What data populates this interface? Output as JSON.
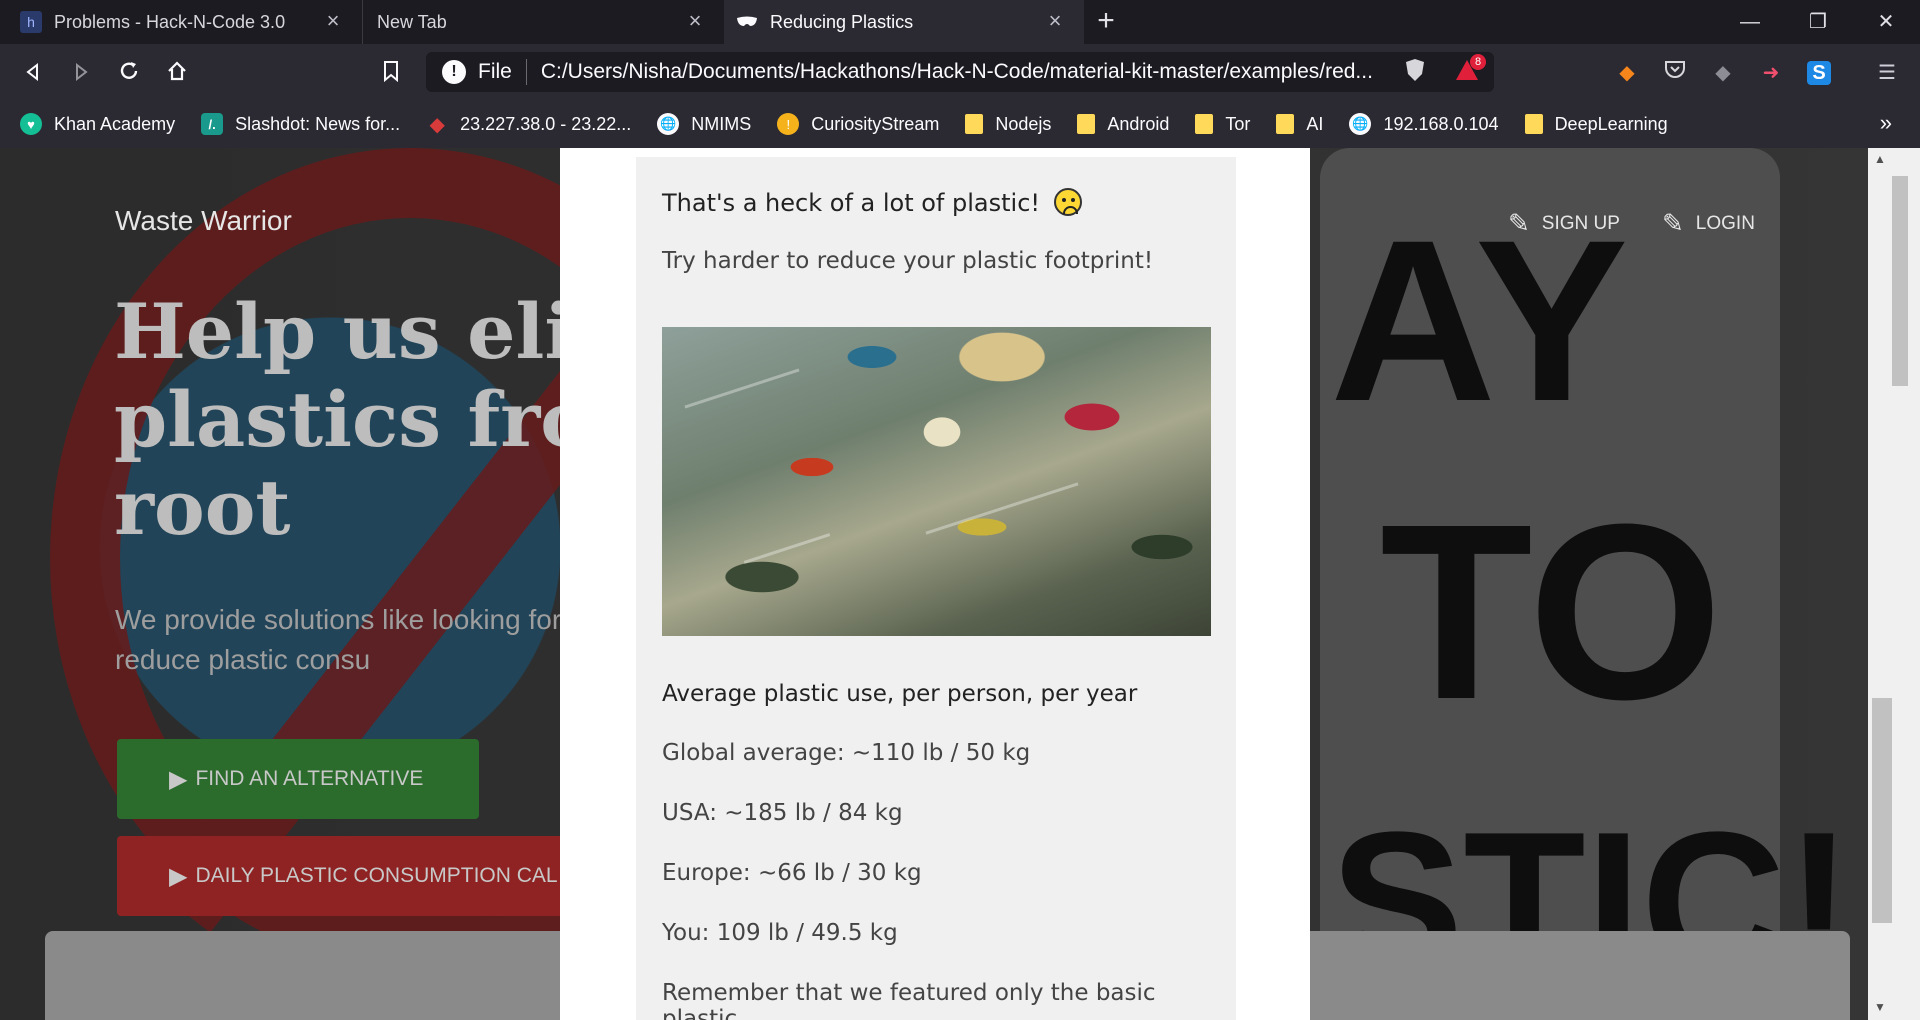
{
  "tabs": [
    {
      "title": "Problems - Hack-N-Code 3.0",
      "favicon": "h",
      "active": false
    },
    {
      "title": "New Tab",
      "favicon": "",
      "active": false
    },
    {
      "title": "Reducing Plastics",
      "favicon": "mask-icon",
      "active": true
    }
  ],
  "window": {
    "new_tab": "+",
    "minimize": "—",
    "restore": "❐",
    "close": "✕"
  },
  "address_bar": {
    "scheme": "File",
    "url": "C:/Users/Nisha/Documents/Hackathons/Hack-N-Code/material-kit-master/examples/red..."
  },
  "extensions": {
    "brave_badge": "8"
  },
  "bookmarks": [
    {
      "label": "Khan Academy",
      "icon": "khan-icon",
      "color": "#14bf96"
    },
    {
      "label": "Slashdot: News for...",
      "icon": "slashdot-icon",
      "color": "#1a9a8c"
    },
    {
      "label": "23.227.38.0 - 23.22...",
      "icon": "diamond-icon",
      "color": "#d93a3a"
    },
    {
      "label": "NMIMS",
      "icon": "globe-icon",
      "color": "#fbfbfe"
    },
    {
      "label": "CuriosityStream",
      "icon": "curiosity-icon",
      "color": "#f6b21b"
    },
    {
      "label": "Nodejs",
      "icon": "folder-icon",
      "color": "#fed95a"
    },
    {
      "label": "Android",
      "icon": "folder-icon",
      "color": "#fed95a"
    },
    {
      "label": "Tor",
      "icon": "folder-icon",
      "color": "#fed95a"
    },
    {
      "label": "AI",
      "icon": "folder-icon",
      "color": "#fed95a"
    },
    {
      "label": "192.168.0.104",
      "icon": "globe-icon",
      "color": "#fbfbfe"
    },
    {
      "label": "DeepLearning",
      "icon": "folder-icon",
      "color": "#fed95a"
    }
  ],
  "bookmarks_more": "»",
  "site": {
    "brand": "Waste Warrior",
    "nav": {
      "signup": "SIGN UP",
      "login": "LOGIN"
    },
    "hero_title": "Help us elim plastics fron root",
    "hero_sub": "We provide solutions like looking for a and daily goals to reduce plastic consu",
    "btn_alternative": "FIND AN ALTERNATIVE",
    "btn_calculator": "DAILY PLASTIC CONSUMPTION CAL"
  },
  "modal": {
    "heading": "That's a heck of a lot of plastic!",
    "body": "Try harder to reduce your plastic footprint!",
    "image_alt": "plastic-waste-ocean-photo",
    "subheading": "Average plastic use, per person, per year",
    "stats": [
      "Global average: ~110 lb / 50 kg",
      "USA: ~185 lb / 84 kg",
      "Europe: ~66 lb / 30 kg",
      "You: 109 lb / 49.5 kg"
    ],
    "footer": "Remember that we featured only the basic plastic"
  },
  "colors": {
    "green_btn": "#2b6b2c",
    "red_btn": "#8f2323",
    "modal_bg": "#f0f0f0"
  }
}
